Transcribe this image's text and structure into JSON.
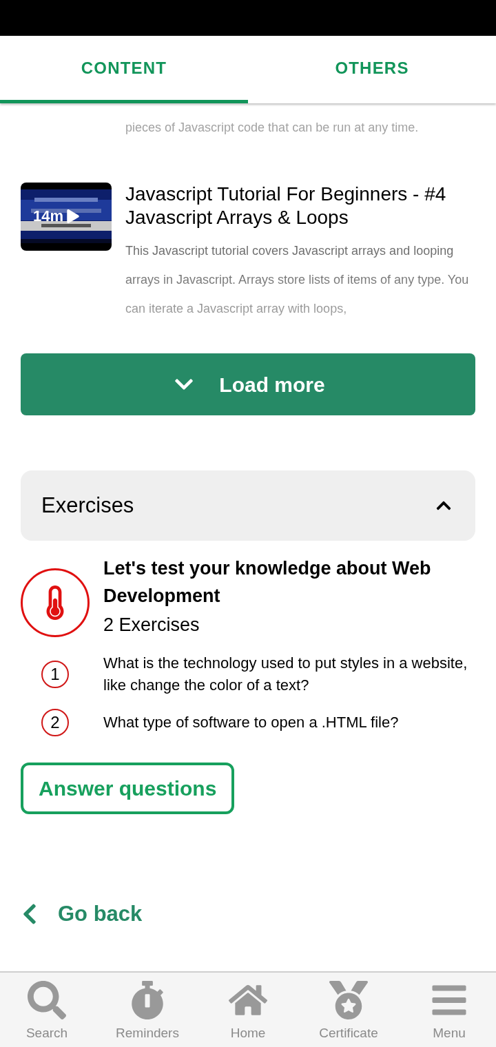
{
  "tabs": [
    {
      "label": "CONTENT",
      "selected": true
    },
    {
      "label": "OTHERS",
      "selected": false
    }
  ],
  "previous_item": {
    "description_tail": "pieces of Javascript code that can be run at any time."
  },
  "videos": [
    {
      "duration": "14m",
      "title": "Javascript Tutorial For Beginners - #4 Javascript Arrays & Loops",
      "description": "This Javascript tutorial covers Javascript arrays and looping arrays in Javascript. Arrays store lists of items of any type. You can iterate a Javascript array with loops,"
    }
  ],
  "load_more": {
    "label": "Load more"
  },
  "exercises": {
    "title": "Exercises",
    "expanded": true,
    "quiz": {
      "title": "Let's test your knowledge about Web Development",
      "count": "2 Exercises",
      "questions": [
        {
          "number": "1",
          "text": "What is the technology used to put styles in a website, like change the color of a text?"
        },
        {
          "number": "2",
          "text": "What type of software to open a .HTML file?"
        }
      ]
    },
    "answer_button": "Answer questions"
  },
  "go_back": "Go back",
  "bottom_nav": [
    {
      "kind": "search",
      "label": "Search"
    },
    {
      "kind": "stopwatch",
      "label": "Reminders"
    },
    {
      "kind": "home",
      "label": "Home"
    },
    {
      "kind": "medal",
      "label": "Certificate"
    },
    {
      "kind": "menu",
      "label": "Menu"
    }
  ]
}
